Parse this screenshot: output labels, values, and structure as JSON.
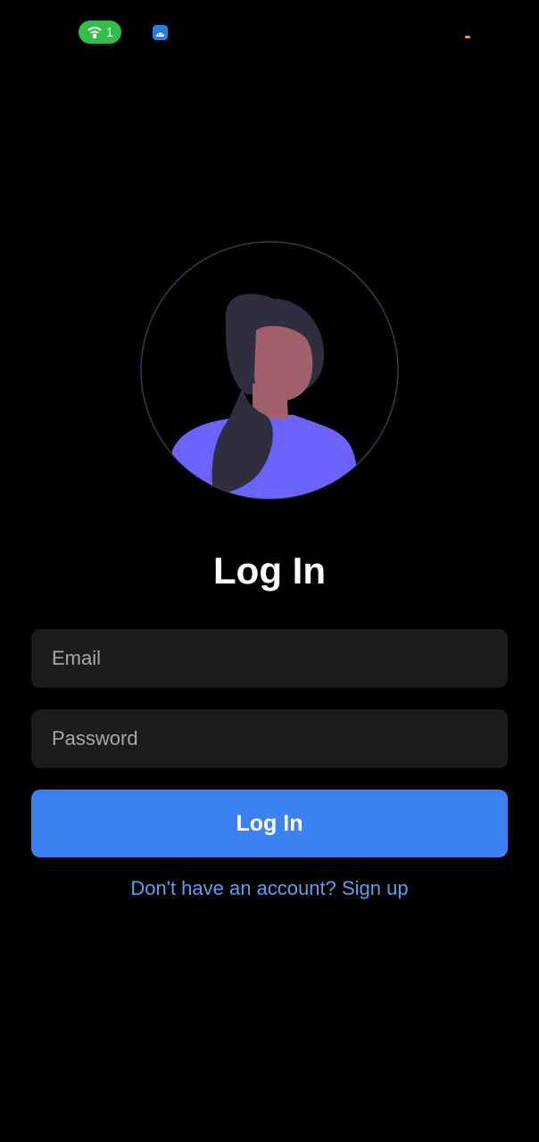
{
  "status_bar": {
    "hotspot_count": "1",
    "hotspot_icon": "wifi-hotspot-icon",
    "notification_icon": "android-app-icon"
  },
  "avatar": {
    "icon": "female-user-avatar-illustration"
  },
  "login": {
    "title": "Log In",
    "email_placeholder": "Email",
    "password_placeholder": "Password",
    "button_label": "Log In",
    "signup_prompt": "Don't have an account? Sign up"
  },
  "colors": {
    "background": "#000000",
    "field_background": "#1c1c1e",
    "button_primary": "#3d82f2",
    "link": "#5d9ef0",
    "avatar_shirt": "#6c63ff",
    "avatar_hair": "#2f2e41",
    "avatar_skin": "#a0616a"
  }
}
